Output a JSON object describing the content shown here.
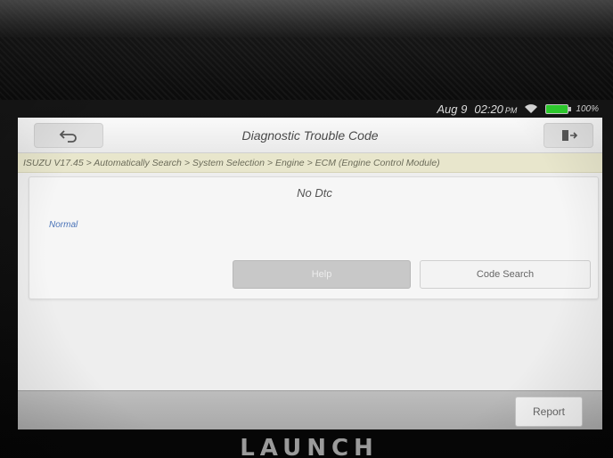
{
  "status_bar": {
    "date": "Aug 9",
    "time": "02:20",
    "time_suffix": "PM",
    "battery": "100%",
    "wifi_icon": "wifi-icon",
    "battery_icon": "battery-icon",
    "battery_color": "#2fd12f"
  },
  "title_bar": {
    "title": "Diagnostic Trouble Code",
    "back_icon": "back-arrow-icon",
    "exit_icon": "exit-icon"
  },
  "breadcrumb": {
    "path": "ISUZU V17.45 > Automatically Search > System Selection > Engine > ECM (Engine Control Module)"
  },
  "dtc_card": {
    "message": "No Dtc",
    "status": "Normal",
    "status_color": "#4b74b8",
    "help_label": "Help",
    "code_search_label": "Code Search"
  },
  "bottom_bar": {
    "report_label": "Report"
  },
  "device": {
    "brand": "LAUNCH"
  }
}
